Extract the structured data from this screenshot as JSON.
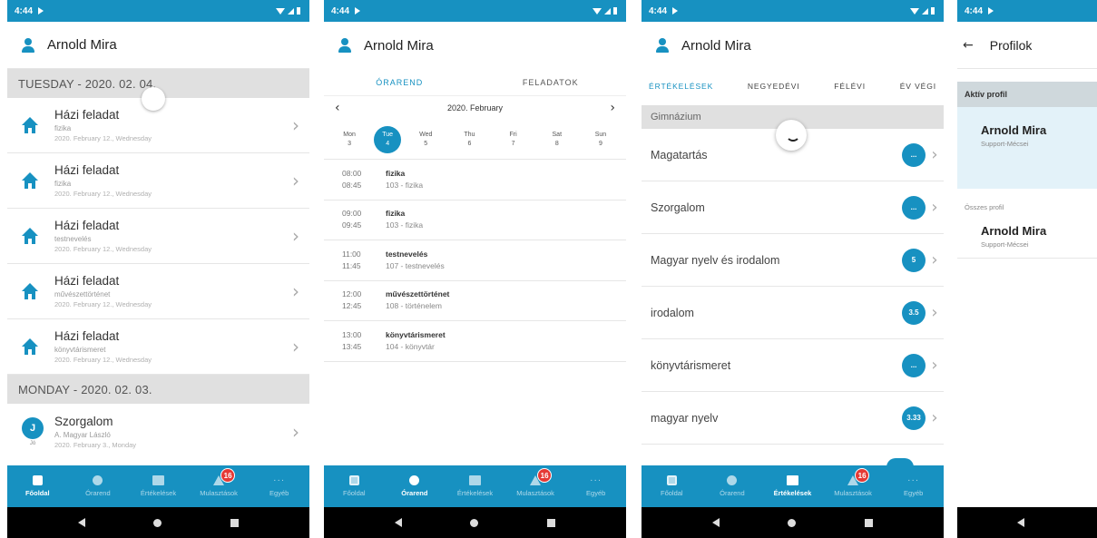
{
  "colors": {
    "primary": "#1791c1",
    "badge": "#e53935",
    "section_bg": "#e0e0e0"
  },
  "status": {
    "time": "4:44"
  },
  "user": {
    "name": "Arnold Mira"
  },
  "nav": {
    "items": [
      {
        "label": "Főoldal",
        "icon": "clipboard-icon"
      },
      {
        "label": "Órarend",
        "icon": "clock-icon"
      },
      {
        "label": "Értékelések",
        "icon": "book-icon"
      },
      {
        "label": "Mulasztások",
        "icon": "warning-icon",
        "badge": "16"
      },
      {
        "label": "Egyéb",
        "icon": "more-icon"
      }
    ]
  },
  "home": {
    "section1": "TUESDAY - 2020. 02. 04.",
    "homework": [
      {
        "title": "Házi feladat",
        "subject": "fizika",
        "date": "2020. February 12., Wednesday"
      },
      {
        "title": "Házi feladat",
        "subject": "fizika",
        "date": "2020. February 12., Wednesday"
      },
      {
        "title": "Házi feladat",
        "subject": "testnevelés",
        "date": "2020. February 12., Wednesday"
      },
      {
        "title": "Házi feladat",
        "subject": "művészettörténet",
        "date": "2020. February 12., Wednesday"
      },
      {
        "title": "Házi feladat",
        "subject": "könyvtárismeret",
        "date": "2020. February 12., Wednesday"
      }
    ],
    "section2": "MONDAY - 2020. 02. 03.",
    "evaluation": {
      "title": "Szorgalom",
      "teacher": "A. Magyar László",
      "date": "2020. February 3., Monday",
      "avatar": "J",
      "avatar_sub": "Jó"
    }
  },
  "timetable": {
    "tabs": [
      "ÓRAREND",
      "FELADATOK"
    ],
    "month": "2020. February",
    "days": [
      {
        "name": "Mon",
        "num": "3"
      },
      {
        "name": "Tue",
        "num": "4"
      },
      {
        "name": "Wed",
        "num": "5"
      },
      {
        "name": "Thu",
        "num": "6"
      },
      {
        "name": "Fri",
        "num": "7"
      },
      {
        "name": "Sat",
        "num": "8"
      },
      {
        "name": "Sun",
        "num": "9"
      }
    ],
    "lessons": [
      {
        "start": "08:00",
        "end": "08:45",
        "subject": "fizika",
        "room": "103 - fizika"
      },
      {
        "start": "09:00",
        "end": "09:45",
        "subject": "fizika",
        "room": "103 - fizika"
      },
      {
        "start": "11:00",
        "end": "11:45",
        "subject": "testnevelés",
        "room": "107 - testnevelés"
      },
      {
        "start": "12:00",
        "end": "12:45",
        "subject": "művészettörténet",
        "room": "108 - történelem"
      },
      {
        "start": "13:00",
        "end": "13:45",
        "subject": "könyvtárismeret",
        "room": "104 - könyvtár"
      }
    ]
  },
  "grades": {
    "tabs": [
      "ÉRTÉKELÉSEK",
      "NEGYEDÉVI",
      "FÉLÉVI",
      "ÉV VÉGI"
    ],
    "school": "Gimnázium",
    "rows": [
      {
        "name": "Magatartás",
        "value": "..."
      },
      {
        "name": "Szorgalom",
        "value": "..."
      },
      {
        "name": "Magyar nyelv és irodalom",
        "value": "5"
      },
      {
        "name": "irodalom",
        "value": "3.5"
      },
      {
        "name": "könyvtárismeret",
        "value": "..."
      },
      {
        "name": "magyar nyelv",
        "value": "3.33"
      }
    ]
  },
  "profiles": {
    "title": "Profilok",
    "active_label": "Aktív profil",
    "all_label": "Összes profil",
    "name": "Arnold Mira",
    "school": "Support-Mécsei"
  }
}
